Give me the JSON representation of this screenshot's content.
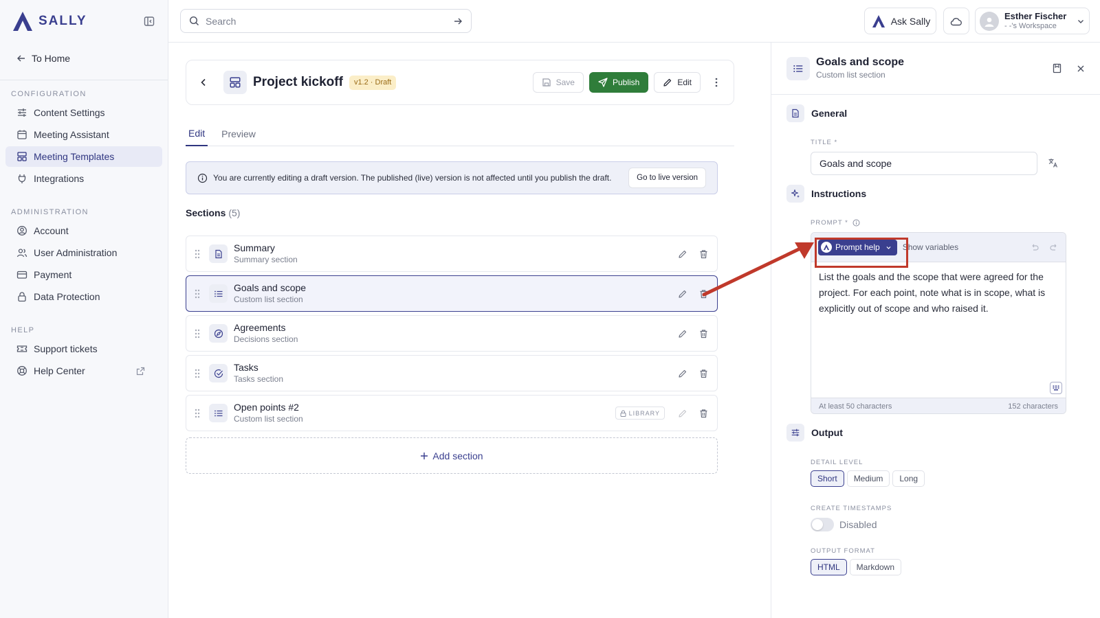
{
  "brand": {
    "name": "SALLY",
    "accent": "#3a3f8f",
    "publish_color": "#2f7d3a"
  },
  "sidebar": {
    "home_label": "To Home",
    "sections": [
      {
        "heading": "CONFIGURATION",
        "items": [
          {
            "label": "Content Settings",
            "icon": "sliders-icon"
          },
          {
            "label": "Meeting Assistant",
            "icon": "calendar-icon"
          },
          {
            "label": "Meeting Templates",
            "icon": "template-icon",
            "active": true
          },
          {
            "label": "Integrations",
            "icon": "plug-icon"
          }
        ]
      },
      {
        "heading": "ADMINISTRATION",
        "items": [
          {
            "label": "Account",
            "icon": "user-circle-icon"
          },
          {
            "label": "User Administration",
            "icon": "users-icon"
          },
          {
            "label": "Payment",
            "icon": "credit-card-icon"
          },
          {
            "label": "Data Protection",
            "icon": "lock-icon"
          }
        ]
      },
      {
        "heading": "HELP",
        "items": [
          {
            "label": "Support tickets",
            "icon": "ticket-icon"
          },
          {
            "label": "Help Center",
            "icon": "lifebuoy-icon"
          }
        ]
      }
    ]
  },
  "topbar": {
    "search_placeholder": "Search",
    "ask_label": "Ask Sally",
    "user_name": "Esther Fischer",
    "workspace": "- -'s Workspace"
  },
  "template": {
    "title": "Project kickoff",
    "version": "v1.2 · Draft",
    "save_label": "Save",
    "publish_label": "Publish",
    "edit_label": "Edit"
  },
  "tabs": [
    "Edit",
    "Preview"
  ],
  "draft_banner": {
    "text": "You are currently editing a draft version. The published (live) version is not affected until you publish the draft.",
    "button": "Go to live version"
  },
  "sections": {
    "heading": "Sections",
    "count": "(5)",
    "items": [
      {
        "title": "Summary",
        "subtitle": "Summary section",
        "icon": "document-icon"
      },
      {
        "title": "Goals and scope",
        "subtitle": "Custom list section",
        "icon": "list-icon",
        "selected": true
      },
      {
        "title": "Agreements",
        "subtitle": "Decisions section",
        "icon": "compass-icon"
      },
      {
        "title": "Tasks",
        "subtitle": "Tasks section",
        "icon": "check-circle-icon"
      },
      {
        "title": "Open points #2",
        "subtitle": "Custom list section",
        "icon": "list-icon",
        "library": "LIBRARY"
      }
    ],
    "add_label": "Add section"
  },
  "panel": {
    "title": "Goals and scope",
    "subtitle": "Custom list section",
    "general_heading": "General",
    "title_label": "TITLE *",
    "title_value": "Goals and scope",
    "instructions_heading": "Instructions",
    "prompt_label": "PROMPT *",
    "prompt_help": "Prompt help",
    "show_variables": "Show variables",
    "prompt_text": "List the goals and the scope that were agreed for the project. For each point, note what is in scope, what is explicitly out of scope and who raised it.",
    "min_chars": "At least 50 characters",
    "char_count": "152 characters",
    "output_heading": "Output",
    "detail_label": "DETAIL LEVEL",
    "detail_options": [
      "Short",
      "Medium",
      "Long"
    ],
    "timestamps_label": "CREATE TIMESTAMPS",
    "timestamps_state": "Disabled",
    "format_label": "OUTPUT FORMAT",
    "format_options": [
      "HTML",
      "Markdown"
    ]
  },
  "annotation": {
    "color": "#c0392b"
  }
}
